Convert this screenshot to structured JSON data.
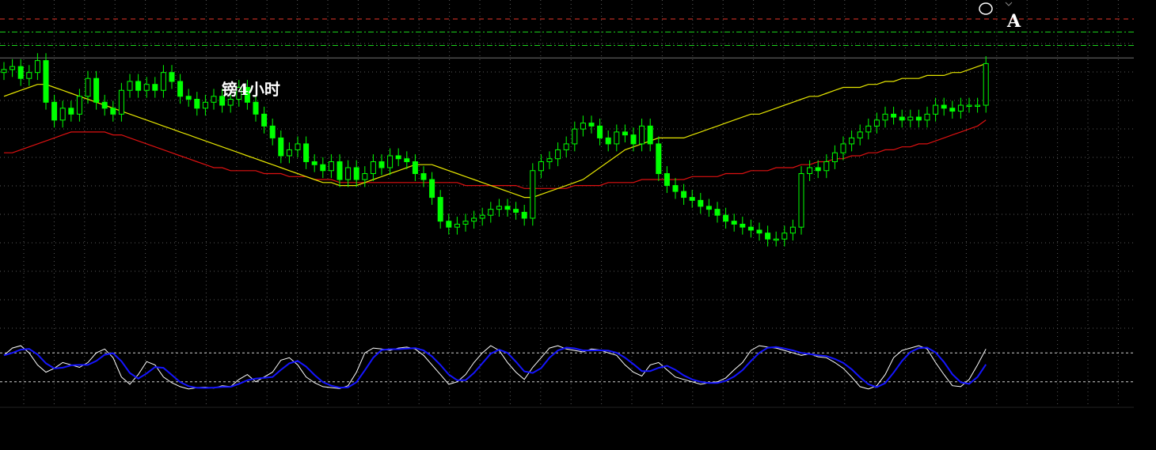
{
  "chart_data": {
    "type": "candlestick",
    "title": "镑4小时",
    "marker_label": "A",
    "x_count": 118,
    "grid": true,
    "colors": {
      "background": "#000000",
      "candle": "#00ff00",
      "ma_fast": "#e6e600",
      "ma_slow": "#dd1111",
      "stoch_k": "#ffffff",
      "stoch_d": "#1515ff",
      "grid": "#5a5a5a",
      "level_red": "#e8362a",
      "level_green": "#1bcf1b"
    },
    "price_ylim": [
      0,
      100
    ],
    "levels": [
      {
        "name": "red-level",
        "value": 100,
        "style": "dash",
        "color": "#e8362a"
      },
      {
        "name": "green-level-1",
        "value": 95.6,
        "style": "dash-dot",
        "color": "#1bcf1b"
      },
      {
        "name": "green-level-2",
        "value": 91.1,
        "style": "dash-dot",
        "color": "#1bcf1b"
      },
      {
        "name": "gray-level",
        "value": 86.9,
        "style": "solid",
        "color": "#707070"
      }
    ],
    "close": [
      83,
      84,
      80,
      82,
      86,
      72,
      66,
      70,
      68,
      74,
      80,
      72,
      70,
      68,
      76,
      79,
      76,
      78,
      76,
      82,
      79,
      74,
      73,
      70,
      72,
      74,
      71,
      73,
      77,
      72,
      68,
      64,
      60,
      54,
      56,
      58,
      52,
      51,
      49,
      52,
      46,
      50,
      46,
      48,
      52,
      50,
      54,
      53,
      52,
      48,
      46,
      40,
      32,
      30,
      31,
      32,
      33,
      34,
      36,
      37,
      36,
      35,
      33,
      49,
      52,
      53,
      56,
      58,
      63,
      65,
      64,
      60,
      58,
      62,
      61,
      58,
      64,
      58,
      48,
      44,
      42,
      40,
      39,
      37,
      36,
      34,
      32,
      31,
      30,
      29,
      28,
      26,
      26,
      28,
      30,
      48,
      50,
      49,
      52,
      55,
      58,
      60,
      62,
      64,
      66,
      68,
      67,
      66,
      67,
      66,
      68,
      71,
      70,
      69,
      71,
      71,
      71,
      85
    ],
    "open": [
      82,
      83,
      84,
      80,
      82,
      86,
      72,
      66,
      70,
      68,
      74,
      80,
      72,
      70,
      68,
      76,
      79,
      76,
      78,
      76,
      82,
      79,
      74,
      73,
      70,
      72,
      74,
      71,
      73,
      77,
      72,
      68,
      64,
      60,
      54,
      56,
      58,
      52,
      51,
      49,
      52,
      46,
      50,
      46,
      48,
      52,
      50,
      54,
      53,
      52,
      48,
      46,
      40,
      32,
      30,
      31,
      32,
      33,
      34,
      36,
      37,
      36,
      35,
      33,
      49,
      52,
      53,
      56,
      58,
      63,
      65,
      64,
      60,
      58,
      62,
      61,
      58,
      64,
      58,
      48,
      44,
      42,
      40,
      39,
      37,
      36,
      34,
      32,
      31,
      30,
      29,
      28,
      26,
      26,
      28,
      30,
      48,
      50,
      49,
      52,
      55,
      58,
      60,
      62,
      64,
      66,
      68,
      67,
      66,
      67,
      66,
      68,
      71,
      70,
      69,
      71,
      71,
      71
    ],
    "ma_fast": [
      74,
      75,
      76,
      77,
      78,
      78,
      77,
      76,
      75,
      74,
      73,
      72,
      71,
      70,
      69,
      68,
      67,
      66,
      65,
      64,
      63,
      62,
      61,
      60,
      59,
      58,
      57,
      56,
      55,
      54,
      53,
      52,
      51,
      50,
      49,
      48,
      47,
      46,
      45,
      45,
      44,
      44,
      44,
      45,
      46,
      47,
      48,
      49,
      50,
      51,
      51,
      51,
      50,
      49,
      48,
      47,
      46,
      45,
      44,
      43,
      42,
      41,
      40,
      40,
      41,
      42,
      43,
      44,
      45,
      46,
      48,
      50,
      52,
      54,
      56,
      57,
      58,
      59,
      60,
      60,
      60,
      60,
      61,
      62,
      63,
      64,
      65,
      66,
      67,
      68,
      68,
      69,
      70,
      71,
      72,
      73,
      74,
      74,
      75,
      76,
      77,
      77,
      77,
      78,
      78,
      79,
      79,
      80,
      80,
      80,
      81,
      81,
      81,
      82,
      82,
      83,
      84,
      85
    ],
    "ma_slow": [
      55,
      55,
      56,
      57,
      58,
      59,
      60,
      61,
      62,
      62,
      62,
      62,
      62,
      61,
      61,
      60,
      59,
      58,
      57,
      56,
      55,
      54,
      53,
      52,
      51,
      50,
      50,
      49,
      49,
      49,
      49,
      48,
      48,
      48,
      47,
      47,
      47,
      46,
      46,
      46,
      45,
      45,
      45,
      45,
      45,
      45,
      45,
      45,
      45,
      45,
      45,
      45,
      45,
      45,
      45,
      44,
      44,
      44,
      44,
      44,
      44,
      44,
      43,
      43,
      43,
      43,
      43,
      43,
      44,
      44,
      44,
      44,
      45,
      45,
      45,
      45,
      46,
      46,
      46,
      46,
      46,
      46,
      47,
      47,
      47,
      47,
      48,
      48,
      48,
      49,
      49,
      49,
      50,
      50,
      50,
      51,
      51,
      52,
      52,
      53,
      53,
      54,
      54,
      55,
      55,
      56,
      56,
      57,
      57,
      58,
      58,
      59,
      60,
      61,
      62,
      63,
      64,
      66
    ],
    "stoch_ylim": [
      0,
      100
    ],
    "stoch_levels": [
      80,
      20
    ],
    "stoch_k": [
      75,
      90,
      95,
      80,
      55,
      40,
      48,
      60,
      55,
      50,
      60,
      80,
      88,
      70,
      30,
      15,
      35,
      62,
      55,
      30,
      18,
      10,
      5,
      8,
      9,
      7,
      12,
      10,
      25,
      35,
      20,
      30,
      40,
      65,
      70,
      55,
      30,
      18,
      10,
      8,
      6,
      12,
      40,
      80,
      90,
      88,
      85,
      90,
      92,
      88,
      75,
      55,
      35,
      15,
      20,
      35,
      60,
      80,
      95,
      85,
      60,
      40,
      25,
      50,
      70,
      90,
      95,
      88,
      85,
      82,
      88,
      86,
      80,
      75,
      55,
      40,
      32,
      55,
      60,
      45,
      30,
      25,
      20,
      15,
      18,
      20,
      28,
      45,
      60,
      85,
      95,
      92,
      90,
      85,
      80,
      75,
      78,
      72,
      70,
      60,
      48,
      30,
      10,
      5,
      12,
      35,
      70,
      85,
      90,
      95,
      88,
      60,
      35,
      12,
      10,
      25,
      55,
      88
    ]
  }
}
